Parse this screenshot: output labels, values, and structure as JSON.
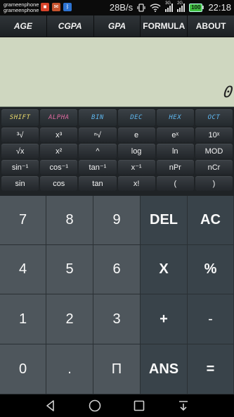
{
  "status_bar": {
    "carrier_line1": "grameenphone",
    "carrier_line2": "grameenphone",
    "net_speed": "28B/s",
    "net_3g": "3G",
    "net_2g": "2G",
    "battery": "100",
    "time": "22:18"
  },
  "tabs": [
    {
      "label": "AGE"
    },
    {
      "label": "CGPA"
    },
    {
      "label": "GPA"
    },
    {
      "label": "FORMULA"
    },
    {
      "label": "ABOUT"
    }
  ],
  "display": {
    "value": "0"
  },
  "mode_keys": [
    {
      "label": "SHIFT"
    },
    {
      "label": "ALPHA"
    },
    {
      "label": "BIN"
    },
    {
      "label": "DEC"
    },
    {
      "label": "HEX"
    },
    {
      "label": "OCT"
    }
  ],
  "function_rows": [
    [
      "³√",
      "x³",
      "ⁿ√",
      "e",
      "eˣ",
      "10ˣ"
    ],
    [
      "√x",
      "x²",
      "^",
      "log",
      "ln",
      "MOD"
    ],
    [
      "sin⁻¹",
      "cos⁻¹",
      "tan⁻¹",
      "x⁻¹",
      "nPr",
      "nCr"
    ],
    [
      "sin",
      "cos",
      "tan",
      "x!",
      "(",
      ")"
    ]
  ],
  "keypad": {
    "k7": "7",
    "k8": "8",
    "k9": "9",
    "del": "DEL",
    "ac": "AC",
    "k4": "4",
    "k5": "5",
    "k6": "6",
    "mul": "X",
    "percent": "%",
    "k1": "1",
    "k2": "2",
    "k3": "3",
    "plus": "+",
    "minus": "-",
    "k0": "0",
    "dot": ".",
    "pi": "Π",
    "ans": "ANS",
    "equals": "="
  },
  "colors": {
    "display_bg": "#cfd7c0",
    "shift": "#e9d86a",
    "alpha": "#e06aa0",
    "base_modes": "#5fb8f0",
    "number_key": "#4e565c",
    "operator_key": "#39434a"
  }
}
